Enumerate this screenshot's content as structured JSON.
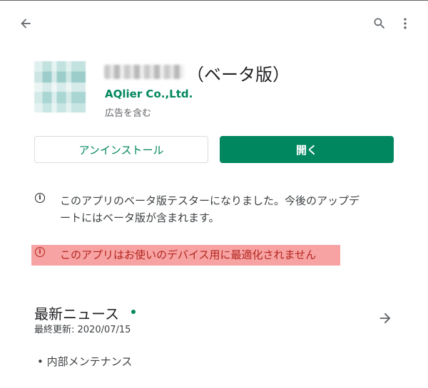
{
  "toolbar": {
    "back_icon": "arrow-back-icon",
    "search_icon": "search-icon",
    "more_icon": "more-vert-icon"
  },
  "app": {
    "title_suffix": "（ベータ版）",
    "developer": "AQlier Co.,Ltd.",
    "ads_label": "広告を含む"
  },
  "actions": {
    "uninstall_label": "アンインストール",
    "open_label": "開く"
  },
  "notices": {
    "beta_message": "このアプリのベータ版テスターになりました。今後のアップデートにはベータ版が含まれます。",
    "device_warning": "このアプリはお使いのデバイス用に最適化されません"
  },
  "news": {
    "title": "最新ニュース",
    "updated": "最終更新: 2020/07/15",
    "item": "• 内部メンテナンス"
  },
  "colors": {
    "accent": "#01875f",
    "warning_bg": "#f7a3a3",
    "warning_text": "#b3261e"
  }
}
